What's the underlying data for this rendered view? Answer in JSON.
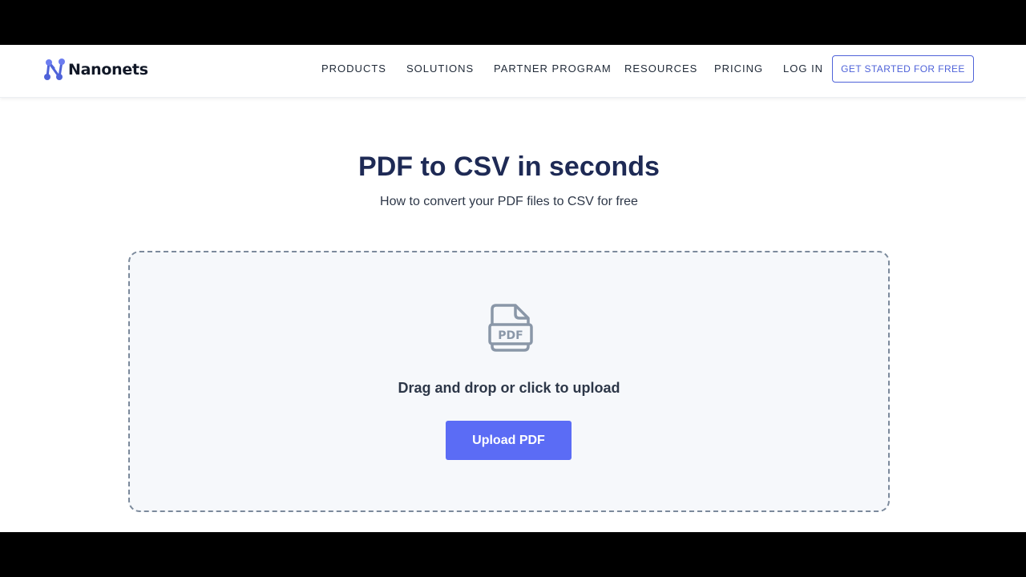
{
  "brand": {
    "name": "Nanonets",
    "logo_icon": "nanonets-logo-icon",
    "accent_color": "#5b6cf5"
  },
  "nav": {
    "items": [
      {
        "label": "PRODUCTS"
      },
      {
        "label": "SOLUTIONS"
      },
      {
        "label": "PARTNER PROGRAM"
      },
      {
        "label": "RESOURCES"
      },
      {
        "label": "PRICING"
      },
      {
        "label": "LOG IN"
      }
    ],
    "cta_label": "GET STARTED FOR FREE"
  },
  "hero": {
    "title": "PDF to CSV in seconds",
    "subtitle": "How to convert your PDF files to CSV for free"
  },
  "upload": {
    "icon": "pdf-file-icon",
    "icon_text": "PDF",
    "prompt": "Drag and drop or click to upload",
    "button_label": "Upload PDF"
  }
}
